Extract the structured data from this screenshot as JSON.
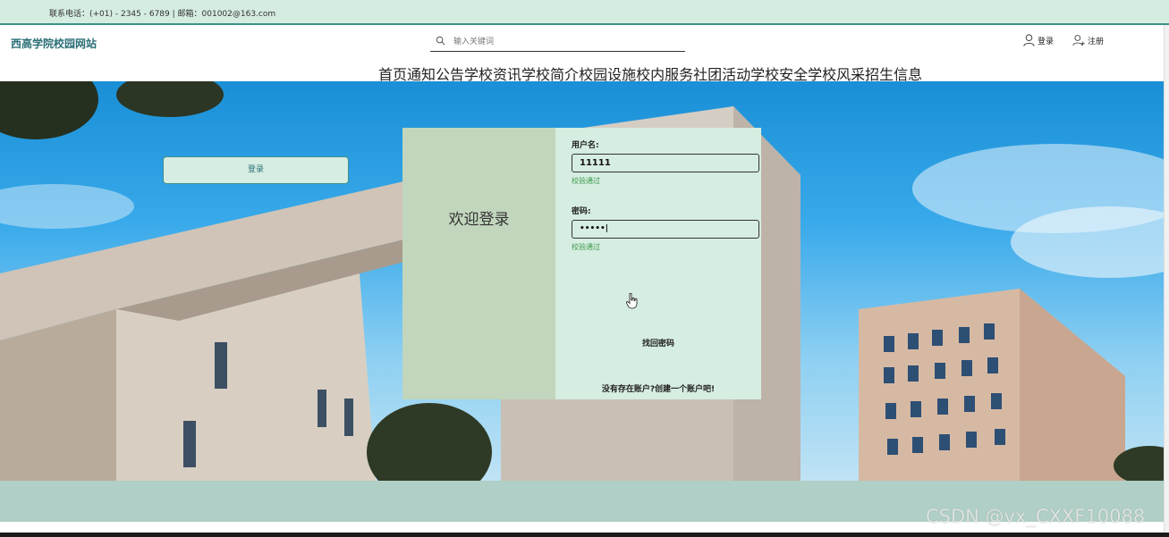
{
  "topbar": {
    "contact": "联系电话：(+01) - 2345 - 6789 | 邮箱：001002@163.com"
  },
  "header": {
    "site_title": "西高学院校园网站",
    "search_placeholder": "输入关键词",
    "login_label": "登录",
    "register_label": "注册"
  },
  "nav": {
    "items": [
      "首页",
      "通知公告",
      "学校资讯",
      "学校简介",
      "校园设施",
      "校内服务",
      "社团活动",
      "学校安全",
      "学校风采",
      "招生信息"
    ]
  },
  "login": {
    "welcome": "欢迎登录",
    "username_label": "用户名:",
    "username_value": "11111",
    "username_hint": "校验通过",
    "password_label": "密码:",
    "password_value": "•••••|",
    "password_hint": "校验通过",
    "submit_label": "登录",
    "find_password": "找回密码",
    "create_account": "没有存在账户?创建一个账户吧!"
  },
  "watermark": "CSDN @vx_CXXF10088",
  "colors": {
    "accent": "#3f8f8c",
    "panel_left": "#c1d6bd",
    "panel_right": "#d6ede1",
    "hint": "#3a9a4a"
  }
}
